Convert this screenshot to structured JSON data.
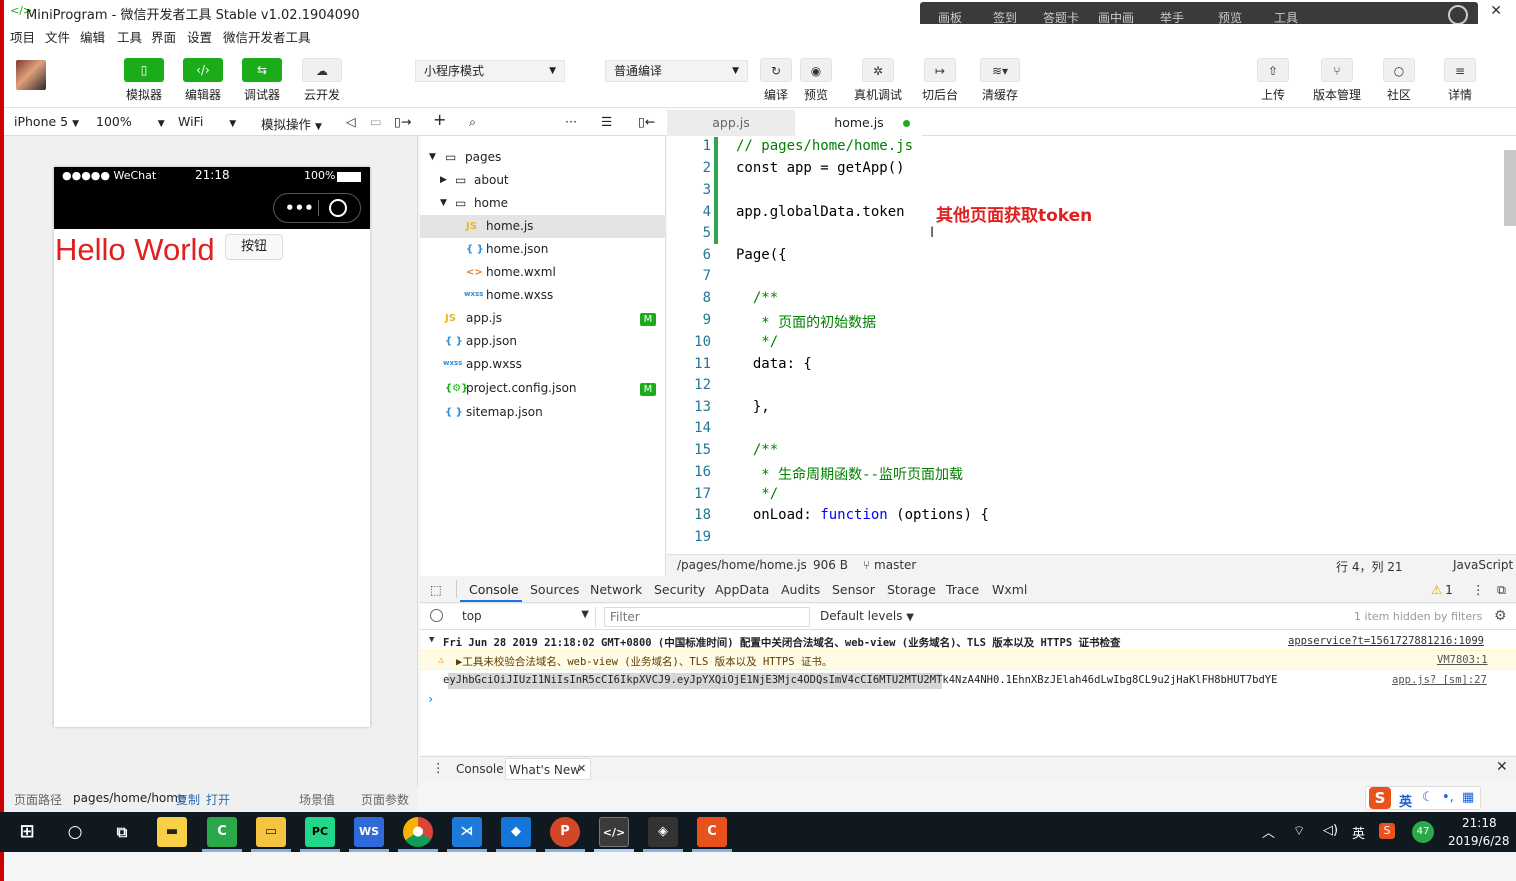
{
  "titlebar": {
    "title": "MiniProgram - 微信开发者工具 Stable v1.02.1904090",
    "close": "✕"
  },
  "overlay": {
    "items": [
      "画板",
      "签到",
      "答题卡",
      "画中画",
      "举手",
      "预览",
      "工具"
    ]
  },
  "menubar": [
    "项目",
    "文件",
    "编辑",
    "工具",
    "界面",
    "设置",
    "微信开发者工具"
  ],
  "toolbar": {
    "simulator": "模拟器",
    "editor": "编辑器",
    "debugger": "调试器",
    "cloud": "云开发",
    "mode": "小程序模式",
    "compile_mode": "普通编译",
    "compile": "编译",
    "preview": "预览",
    "real_debug": "真机调试",
    "background": "切后台",
    "clear_cache": "清缓存",
    "upload": "上传",
    "version": "版本管理",
    "community": "社区",
    "details": "详情"
  },
  "subbar": {
    "device": "iPhone 5",
    "zoom": "100%",
    "network": "WiFi",
    "sim_ops": "模拟操作"
  },
  "phone": {
    "carrier": "●●●●● WeChat",
    "time": "21:18",
    "battery": "100%",
    "hello": "Hello World",
    "button": "按钮"
  },
  "tree": {
    "pages": "pages",
    "about": "about",
    "home": "home",
    "home_js": "home.js",
    "home_json": "home.json",
    "home_wxml": "home.wxml",
    "home_wxss": "home.wxss",
    "app_js": "app.js",
    "app_json": "app.json",
    "app_wxss": "app.wxss",
    "project_config": "project.config.json",
    "sitemap": "sitemap.json",
    "badge": "M"
  },
  "tabs": {
    "tab1": "app.js",
    "tab2": "home.js"
  },
  "editor": {
    "lines": [
      "1",
      "2",
      "3",
      "4",
      "5",
      "6",
      "7",
      "8",
      "9",
      "10",
      "11",
      "12",
      "13",
      "14",
      "15",
      "16",
      "17",
      "18",
      "19"
    ],
    "code": {
      "l1": "// pages/home/home.js",
      "l2": "const app = getApp()",
      "l4": "app.globalData.token",
      "l6": "Page({",
      "l8": "  /**",
      "l9": "   * 页面的初始数据",
      "l10": "   */",
      "l11": "  data: {",
      "l13": "  },",
      "l15": "  /**",
      "l16": "   * 生命周期函数--监听页面加载",
      "l17": "   */",
      "l18a": "  onLoad: ",
      "l18b": "function",
      "l18c": " (options) {"
    },
    "annotation": "其他页面获取token"
  },
  "status": {
    "path": "/pages/home/home.js",
    "size": "906 B",
    "branch": "master",
    "pos": "行 4，列 21",
    "lang": "JavaScript"
  },
  "devtools": {
    "tabs": [
      "Console",
      "Sources",
      "Network",
      "Security",
      "AppData",
      "Audits",
      "Sensor",
      "Storage",
      "Trace",
      "Wxml"
    ],
    "warn_count": "1",
    "context": "top",
    "filter_placeholder": "Filter",
    "levels": "Default levels",
    "hidden": "1 item hidden by filters",
    "log1": "Fri Jun 28 2019 21:18:02 GMT+0800 (中国标准时间) 配置中关闭合法域名、web-view (业务域名)、TLS 版本以及 HTTPS 证书检查",
    "log1_src": "appservice?t=1561727881216:1099",
    "log2": "▶工具未校验合法域名、web-view (业务域名)、TLS 版本以及 HTTPS 证书。",
    "log2_src": "VM7803:1",
    "log3": "eyJhbGciOiJIUzI1NiIsInR5cCI6IkpXVCJ9.eyJpYXQiOjE1NjE3Mjc4ODQsImV4cCI6MTU2MTU2MTk4NzA4NH0.1EhnXBzJElah46dLwIbg8CL9u2jHaKlFH8bHUT7bdYE",
    "log3_src": "app.js? [sm]:27",
    "drawer_console": "Console",
    "drawer_whatsnew": "What's New"
  },
  "pathbar": {
    "label": "页面路径",
    "path": "pages/home/home",
    "copy": "复制",
    "open": "打开",
    "scene": "场景值",
    "params": "页面参数"
  },
  "ime": {
    "lang": "英"
  },
  "taskbar": {
    "time": "21:18",
    "date": "2019/6/28",
    "ime": "英",
    "badge": "47"
  }
}
